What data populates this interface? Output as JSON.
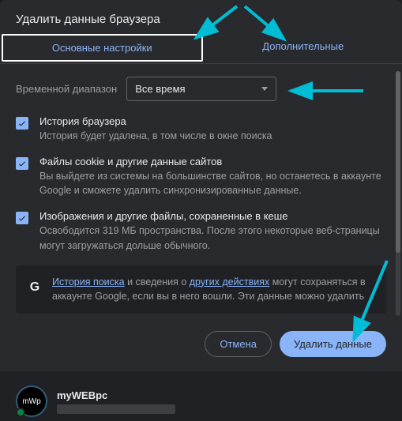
{
  "title": "Удалить данные браузера",
  "tabs": {
    "basic": "Основные настройки",
    "advanced": "Дополнительные"
  },
  "range": {
    "label": "Временной диапазон",
    "value": "Все время"
  },
  "options": [
    {
      "title": "История браузера",
      "sub": "История будет удалена, в том числе в окне поиска"
    },
    {
      "title": "Файлы cookie и другие данные сайтов",
      "sub": "Вы выйдете из системы на большинстве сайтов, но останетесь в аккаунте Google и сможете удалить синхронизированные данные."
    },
    {
      "title": "Изображения и другие файлы, сохраненные в кеше",
      "sub": "Освободится 319 МБ пространства. После этого некоторые веб-страницы могут загружаться дольше обычного."
    }
  ],
  "info": {
    "link1": "История поиска",
    "mid1": " и сведения о ",
    "link2": "других действиях",
    "mid2": " могут сохраняться в аккаунте Google, если вы в него вошли. Эти данные можно удалить"
  },
  "buttons": {
    "cancel": "Отмена",
    "confirm": "Удалить данные"
  },
  "profile": {
    "name": "myWEBpc",
    "avatar": "mWp"
  },
  "annotation_color": "#00bcd4"
}
